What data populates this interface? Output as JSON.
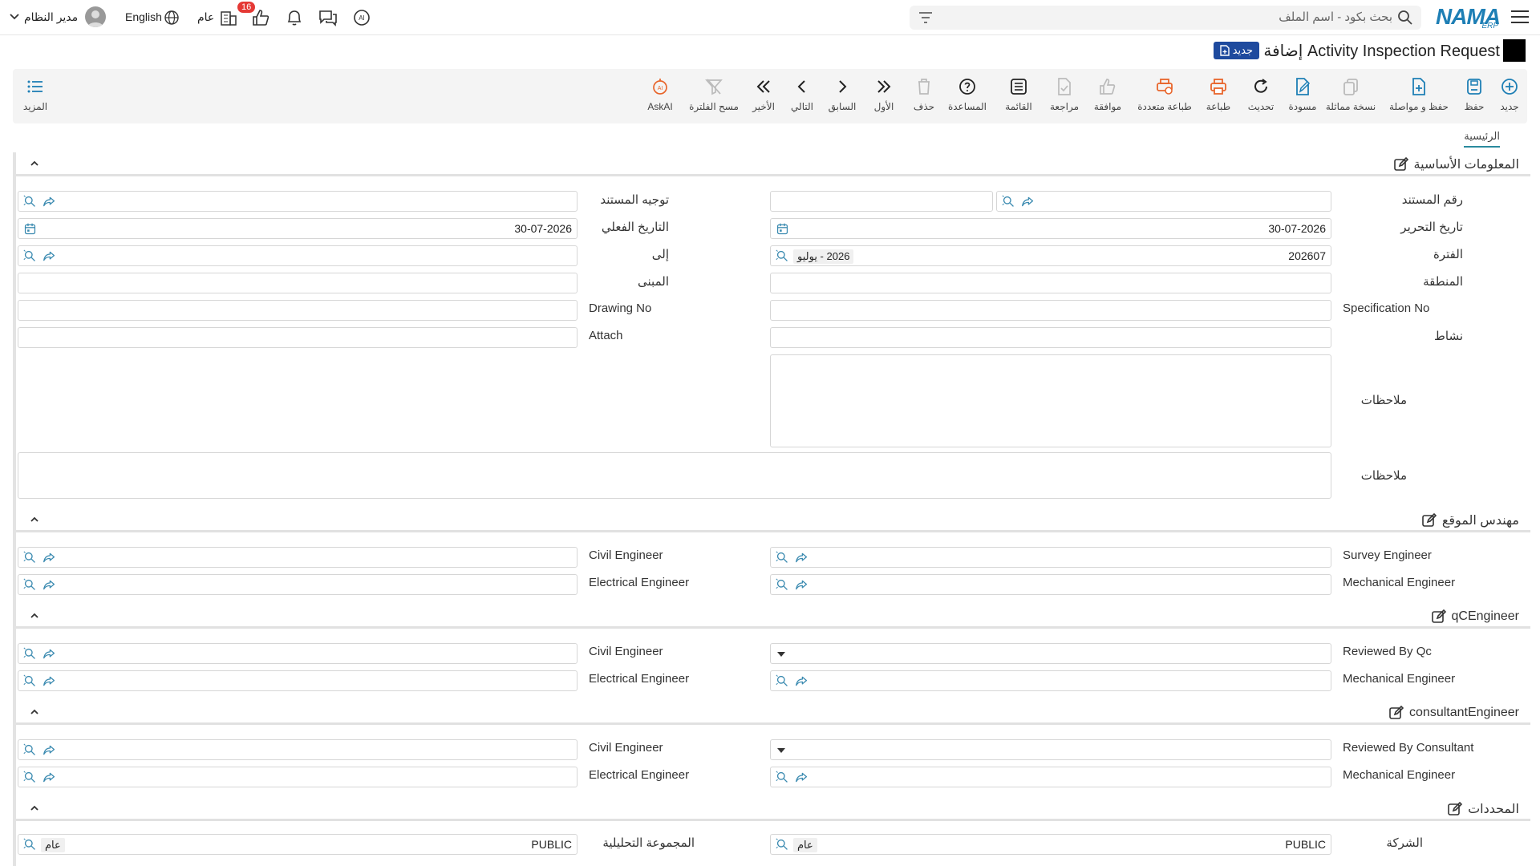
{
  "topbar": {
    "logo_text": "NAMA",
    "logo_sub": "ERP",
    "search_placeholder": "بحث بكود - اسم الملف",
    "notification_count": "16",
    "public_label": "عام",
    "language": "English",
    "user": "مدير النظام"
  },
  "title": {
    "text": "Activity Inspection Request إضافة",
    "new_badge": "جديد"
  },
  "toolbar": {
    "new": "جديد",
    "save": "حفظ",
    "save_continue": "حفظ و مواصلة",
    "duplicate": "نسخة مماثلة",
    "draft": "مسودة",
    "refresh": "تحديث",
    "print": "طباعة",
    "multi_print": "طباعة متعددة",
    "approve": "موافقة",
    "review": "مراجعة",
    "list": "القائمة",
    "help": "المساعدة",
    "delete": "حذف",
    "first": "الأول",
    "prev": "السابق",
    "next": "التالي",
    "last": "الأخير",
    "clear_filter": "مسح الفلترة",
    "askai": "AskAI",
    "more": "المزيد"
  },
  "tabs": {
    "main": "الرئيسية"
  },
  "basic": {
    "title": "المعلومات الأساسية",
    "doc_no": "رقم المستند",
    "doc_direction": "توجيه المستند",
    "edit_date": "تاريخ التحرير",
    "edit_date_value": "30-07-2026",
    "actual_date": "التاريخ الفعلي",
    "actual_date_value": "30-07-2026",
    "period": "الفترة",
    "period_value": "202607",
    "period_chip": "2026 - يوليو",
    "to": "إلى",
    "region": "المنطقة",
    "building": "المبنى",
    "spec_no": "Specification No",
    "drawing_no": "Drawing No",
    "activity": "نشاط",
    "attach": "Attach",
    "notes1": "ملاحظات",
    "notes2": "ملاحظات"
  },
  "site": {
    "title": "مهندس الموقع",
    "survey": "Survey Engineer",
    "civil": "Civil Engineer",
    "mechanical": "Mechanical Engineer",
    "electrical": "Electrical Engineer"
  },
  "qc": {
    "title": "qCEngineer",
    "reviewed": "Reviewed By Qc",
    "civil": "Civil Engineer",
    "mechanical": "Mechanical Engineer",
    "electrical": "Electrical Engineer"
  },
  "consultant": {
    "title": "consultantEngineer",
    "reviewed": "Reviewed By Consultant",
    "civil": "Civil Engineer",
    "mechanical": "Mechanical Engineer",
    "electrical": "Electrical Engineer"
  },
  "dims": {
    "title": "المحددات",
    "company": "الشركة",
    "company_value": "PUBLIC",
    "company_chip": "عام",
    "analytic": "المجموعة التحليلية",
    "analytic_value": "PUBLIC",
    "analytic_chip": "عام"
  },
  "colors": {
    "brand": "#1e7fb5",
    "badge_red": "#e53935",
    "new_badge": "#1e4a9e",
    "orange": "#e8652b",
    "icon_blue": "#3a8ab0"
  }
}
